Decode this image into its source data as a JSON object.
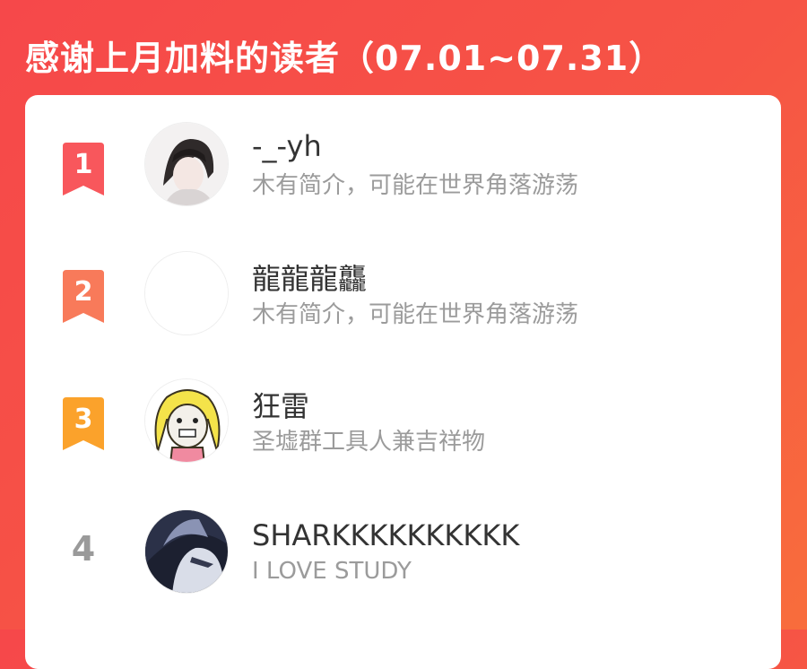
{
  "header": {
    "title": "感谢上月加料的读者（07.01~07.31）"
  },
  "colors": {
    "background_start": "#f6484a",
    "background_end": "#f86d3c",
    "rank1": "#f8575c",
    "rank2": "#f87a5a",
    "rank3": "#fba22b",
    "rank_plain": "#9a9a9a"
  },
  "readers": [
    {
      "rank": "1",
      "name": "-_-yh",
      "bio": "木有简介，可能在世界角落游荡",
      "badge": "ribbon-badge-red",
      "avatar_icon": "anime-boy-avatar"
    },
    {
      "rank": "2",
      "name": "龍龍龍龘",
      "bio": "木有简介，可能在世界角落游荡",
      "badge": "ribbon-badge-coral",
      "avatar_icon": "blank-avatar"
    },
    {
      "rank": "3",
      "name": "狂雷",
      "bio": "圣墟群工具人兼吉祥物",
      "badge": "ribbon-badge-orange",
      "avatar_icon": "blonde-cartoon-avatar"
    },
    {
      "rank": "4",
      "name": "SHARKKKKKKKKKK",
      "bio": "I LOVE STUDY",
      "badge": "none",
      "avatar_icon": "dark-anime-avatar"
    }
  ]
}
